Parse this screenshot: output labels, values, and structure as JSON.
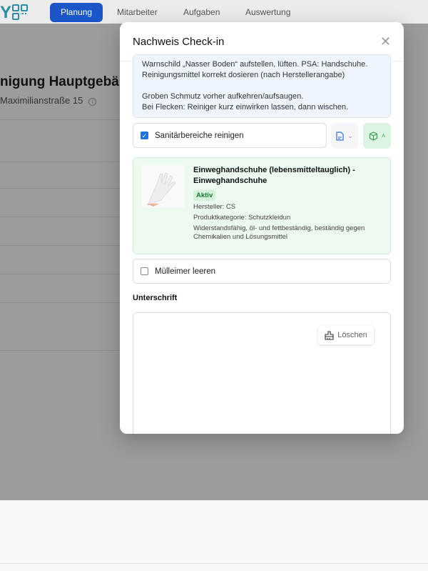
{
  "nav": {
    "logo": "Y",
    "tabs": [
      "Planung",
      "Mitarbeiter",
      "Aufgaben",
      "Auswertung"
    ],
    "active": "Planung"
  },
  "page": {
    "title": "nigung Hauptgebäud",
    "address": "Maximilianstraße 15"
  },
  "modal": {
    "title": "Nachweis Check-in",
    "note_lines": [
      "Warnschild „Nasser Boden“ aufstellen, lüften. PSA: Handschuhe.",
      "Reinigungsmittel korrekt dosieren (nach Herstellerangabe)",
      "",
      "Groben Schmutz vorher aufkehren/aufsaugen.",
      "Bei Flecken: Reiniger kurz einwirken lassen, dann wischen."
    ],
    "tasks": [
      {
        "label": "Sanitärbereiche reinigen",
        "checked": true
      },
      {
        "label": "Mülleimer leeren",
        "checked": false
      }
    ],
    "product": {
      "title": "Einweghandschuhe (lebensmitteltauglich) - Einweghandschuhe",
      "status": "Aktiv",
      "manufacturer": "Hersteller: CS",
      "category": "Produktkategorie: Schutzkleidun",
      "description": "Widerstandsfähig, öl- und fettbeständig, beständig gegen Chemikalien und Lösungsmittel"
    },
    "signature_label": "Unterschrift",
    "clear_label": "Löschen"
  },
  "colors": {
    "primary": "#1b56c9",
    "success_bg": "#ecfaef",
    "info_bg": "#eef5fd"
  }
}
